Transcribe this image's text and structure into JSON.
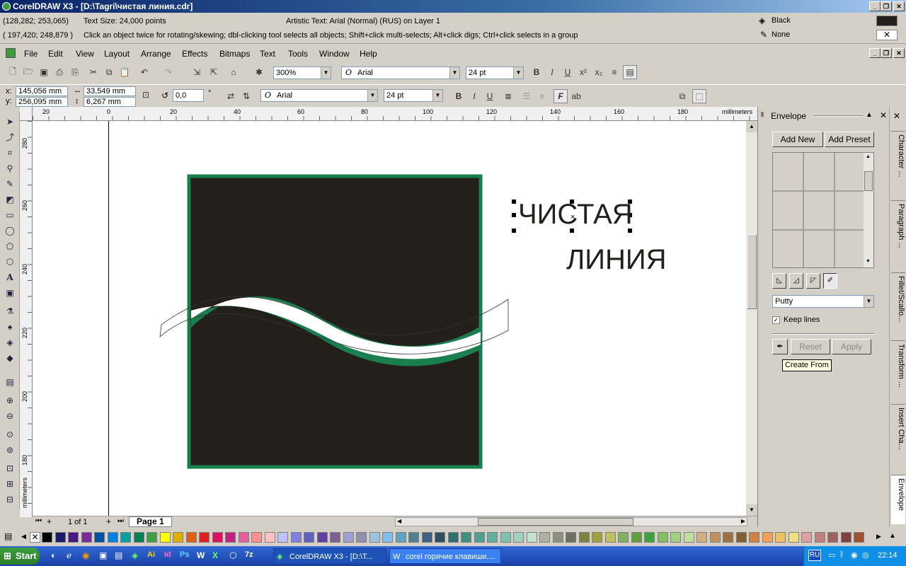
{
  "window": {
    "title": "CorelDRAW X3 - [D:\\Tagri\\чистая линия.cdr]",
    "min": "_",
    "restore": "❐",
    "close": "✕"
  },
  "status": {
    "coords1": "(128,282; 253,065)",
    "textsize": "Text Size: 24,000 points",
    "objinfo": "Artistic Text: Arial (Normal) (RUS) on Layer 1",
    "coords2": "( 197,420; 248,879 )",
    "hint": "Click an object twice for rotating/skewing; dbl-clicking tool selects all objects; Shift+click multi-selects; Alt+click digs; Ctrl+click selects in a group",
    "fill_label": "Black",
    "outline_label": "None"
  },
  "menu": [
    "File",
    "Edit",
    "View",
    "Layout",
    "Arrange",
    "Effects",
    "Bitmaps",
    "Text",
    "Tools",
    "Window",
    "Help"
  ],
  "toolbar": {
    "zoom": "300%",
    "font": "Arial",
    "size": "24 pt"
  },
  "propbar": {
    "x_label": "x:",
    "x": "145,056 mm",
    "y_label": "y:",
    "y": "256,095 mm",
    "w": "33,549 mm",
    "h": "6,267 mm",
    "angle": "0,0",
    "deg": "°",
    "font": "Arial",
    "size": "24 pt"
  },
  "ruler": {
    "units": "millimeters",
    "hticks": [
      "20",
      "0",
      "20",
      "40",
      "60",
      "80",
      "100",
      "120",
      "140",
      "160",
      "180"
    ],
    "vticks": [
      "280",
      "260",
      "240",
      "220",
      "200",
      "180"
    ],
    "vunits": "millimeters"
  },
  "artwork": {
    "line1": "ЧИСТАЯ",
    "line2": "ЛИНИЯ",
    "dark_color": "#23201c",
    "green_color": "#1a7f4f"
  },
  "pages": {
    "counter": "1 of 1",
    "tab": "Page 1"
  },
  "docker": {
    "title": "Envelope",
    "add_new": "Add New",
    "add_preset": "Add Preset",
    "mapping": "Putty",
    "keep_lines": "Keep lines",
    "reset": "Reset",
    "apply": "Apply",
    "tooltip": "Create From"
  },
  "sidetabs": [
    "Character ...",
    "Paragraph ...",
    "Fillet/Scallo...",
    "Transform ...",
    "Insert Cha...",
    "Envelope"
  ],
  "palette": [
    "#000000",
    "#1a1a6e",
    "#4a1a80",
    "#7a2a9a",
    "#0050a0",
    "#0080e0",
    "#00a0a0",
    "#008050",
    "#40a040",
    "#ffff00",
    "#e0b000",
    "#e06010",
    "#e02020",
    "#e01060",
    "#c02080",
    "#e060a0",
    "#ff9090",
    "#ffc0c0",
    "#c0c0ff",
    "#8080e0",
    "#6060c0",
    "#6040a0",
    "#806090",
    "#a0a0d0",
    "#9090b0",
    "#a0c0e0",
    "#80c0f0",
    "#60a0c0",
    "#508090",
    "#406080",
    "#305060",
    "#307070",
    "#409080",
    "#50a090",
    "#60b0a0",
    "#80c0b0",
    "#a0d0c0",
    "#c0e0d0",
    "#b0b0a0",
    "#909080",
    "#707060",
    "#808040",
    "#a0a040",
    "#c0c060",
    "#80b060",
    "#60a040",
    "#40a040",
    "#80c060",
    "#a0d080",
    "#c0e0a0",
    "#d0b080",
    "#c09060",
    "#a07040",
    "#806030",
    "#d08040",
    "#f0a050",
    "#f0c060",
    "#f0e080",
    "#e0a0a0",
    "#c08080",
    "#a06060",
    "#804040",
    "#a05030"
  ],
  "taskbar": {
    "start": "Start",
    "task1": "CorelDRAW X3 - [D:\\T...",
    "task2": "corel горячие клавиши....",
    "lang": "RU",
    "clock": "22:14"
  }
}
